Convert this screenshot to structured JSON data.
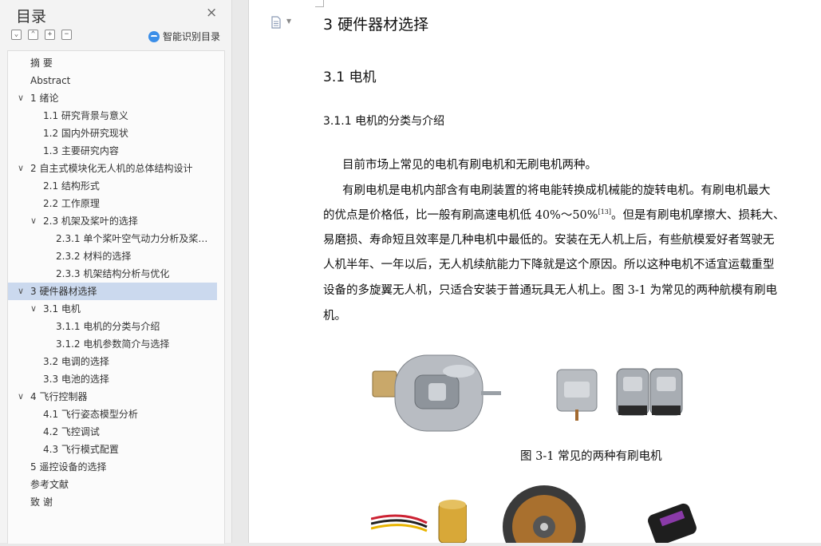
{
  "sidebar": {
    "title": "目录",
    "close": "×",
    "smart_label": "智能识别目录",
    "tools": [
      "⌄",
      "⌃",
      "+",
      "−"
    ],
    "items": [
      {
        "label": "摘  要",
        "indent": 0,
        "toggle": ""
      },
      {
        "label": "Abstract",
        "indent": 0,
        "toggle": ""
      },
      {
        "label": "1  绪论",
        "indent": 0,
        "toggle": "∨"
      },
      {
        "label": "1.1  研究背景与意义",
        "indent": 1,
        "toggle": ""
      },
      {
        "label": "1.2  国内外研究现状",
        "indent": 1,
        "toggle": ""
      },
      {
        "label": "1.3  主要研究内容",
        "indent": 1,
        "toggle": ""
      },
      {
        "label": "2 自主式模块化无人机的总体结构设计",
        "indent": 0,
        "toggle": "∨"
      },
      {
        "label": "2.1 结构形式",
        "indent": 1,
        "toggle": ""
      },
      {
        "label": "2.2 工作原理",
        "indent": 1,
        "toggle": ""
      },
      {
        "label": "2.3 机架及桨叶的选择",
        "indent": 1,
        "toggle": "∨"
      },
      {
        "label": "2.3.1 单个桨叶空气动力分析及桨…",
        "indent": 2,
        "toggle": ""
      },
      {
        "label": "2.3.2 材料的选择",
        "indent": 2,
        "toggle": ""
      },
      {
        "label": "2.3.3 机架结构分析与优化",
        "indent": 2,
        "toggle": ""
      },
      {
        "label": "3 硬件器材选择",
        "indent": 0,
        "toggle": "∨",
        "selected": true
      },
      {
        "label": "3.1 电机",
        "indent": 1,
        "toggle": "∨"
      },
      {
        "label": "3.1.1 电机的分类与介绍",
        "indent": 2,
        "toggle": ""
      },
      {
        "label": "3.1.2 电机参数简介与选择",
        "indent": 2,
        "toggle": ""
      },
      {
        "label": "3.2 电调的选择",
        "indent": 1,
        "toggle": ""
      },
      {
        "label": "3.3 电池的选择",
        "indent": 1,
        "toggle": ""
      },
      {
        "label": "4 飞行控制器",
        "indent": 0,
        "toggle": "∨"
      },
      {
        "label": "4.1 飞行姿态模型分析",
        "indent": 1,
        "toggle": ""
      },
      {
        "label": "4.2 飞控调试",
        "indent": 1,
        "toggle": ""
      },
      {
        "label": "4.3 飞行模式配置",
        "indent": 1,
        "toggle": ""
      },
      {
        "label": "5 遥控设备的选择",
        "indent": 0,
        "toggle": ""
      },
      {
        "label": "参考文献",
        "indent": 0,
        "toggle": ""
      },
      {
        "label": "致   谢",
        "indent": 0,
        "toggle": ""
      }
    ]
  },
  "doc": {
    "h1": "3 硬件器材选择",
    "h2": "3.1 电机",
    "h3": "3.1.1 电机的分类与介绍",
    "p1": "目前市场上常见的电机有刷电机和无刷电机两种。",
    "p2_l1": "有刷电机是电机内部含有电刷装置的将电能转换成机械能的旋转电机。有刷电机最大",
    "p2_l2a": "的优点是价格低，比一般有刷高速电机低 40%～50%",
    "p2_l2_ref": "[13]",
    "p2_l2b": "。但是有刷电机摩擦大、损耗大、",
    "p2_l3": "易磨损、寿命短且效率是几种电机中最低的。安装在无人机上后，有些航模爱好者驾驶无",
    "p2_l4": "人机半年、一年以后，无人机续航能力下降就是这个原因。所以这种电机不适宜运载重型",
    "p2_l5": "设备的多旋翼无人机，只适合安装于普通玩具无人机上。图 3-1 为常见的两种航模有刷电",
    "p2_l6": "机。",
    "caption": "图 3-1 常见的两种有刷电机"
  },
  "colors": {
    "selected_bg": "#cbd9ee",
    "accent": "#3b8ee8"
  }
}
